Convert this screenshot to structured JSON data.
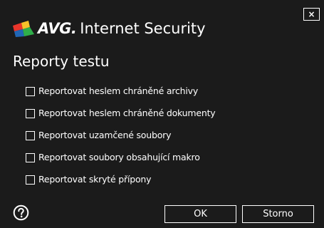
{
  "window": {
    "brand": "AVG.",
    "product": "Internet Security",
    "close_label": "×"
  },
  "dialog": {
    "heading": "Reporty testu",
    "options": [
      {
        "label": "Reportovat heslem chráněné archivy",
        "checked": false
      },
      {
        "label": "Reportovat heslem chráněné dokumenty",
        "checked": false
      },
      {
        "label": "Reportovat uzamčené soubory",
        "checked": false
      },
      {
        "label": "Reportovat soubory obsahující makro",
        "checked": false
      },
      {
        "label": "Reportovat skryté přípony",
        "checked": false
      }
    ]
  },
  "buttons": {
    "ok_label": "OK",
    "cancel_label": "Storno"
  },
  "icons": {
    "logo": "avg-logo-icon",
    "help": "help-icon",
    "close": "close-icon"
  },
  "colors": {
    "background": "#1b1b1b",
    "foreground": "#ffffff",
    "logo_red": "#e9352b",
    "logo_green": "#2fae4a",
    "logo_blue": "#2166b5",
    "logo_yellow": "#f7c12a"
  }
}
